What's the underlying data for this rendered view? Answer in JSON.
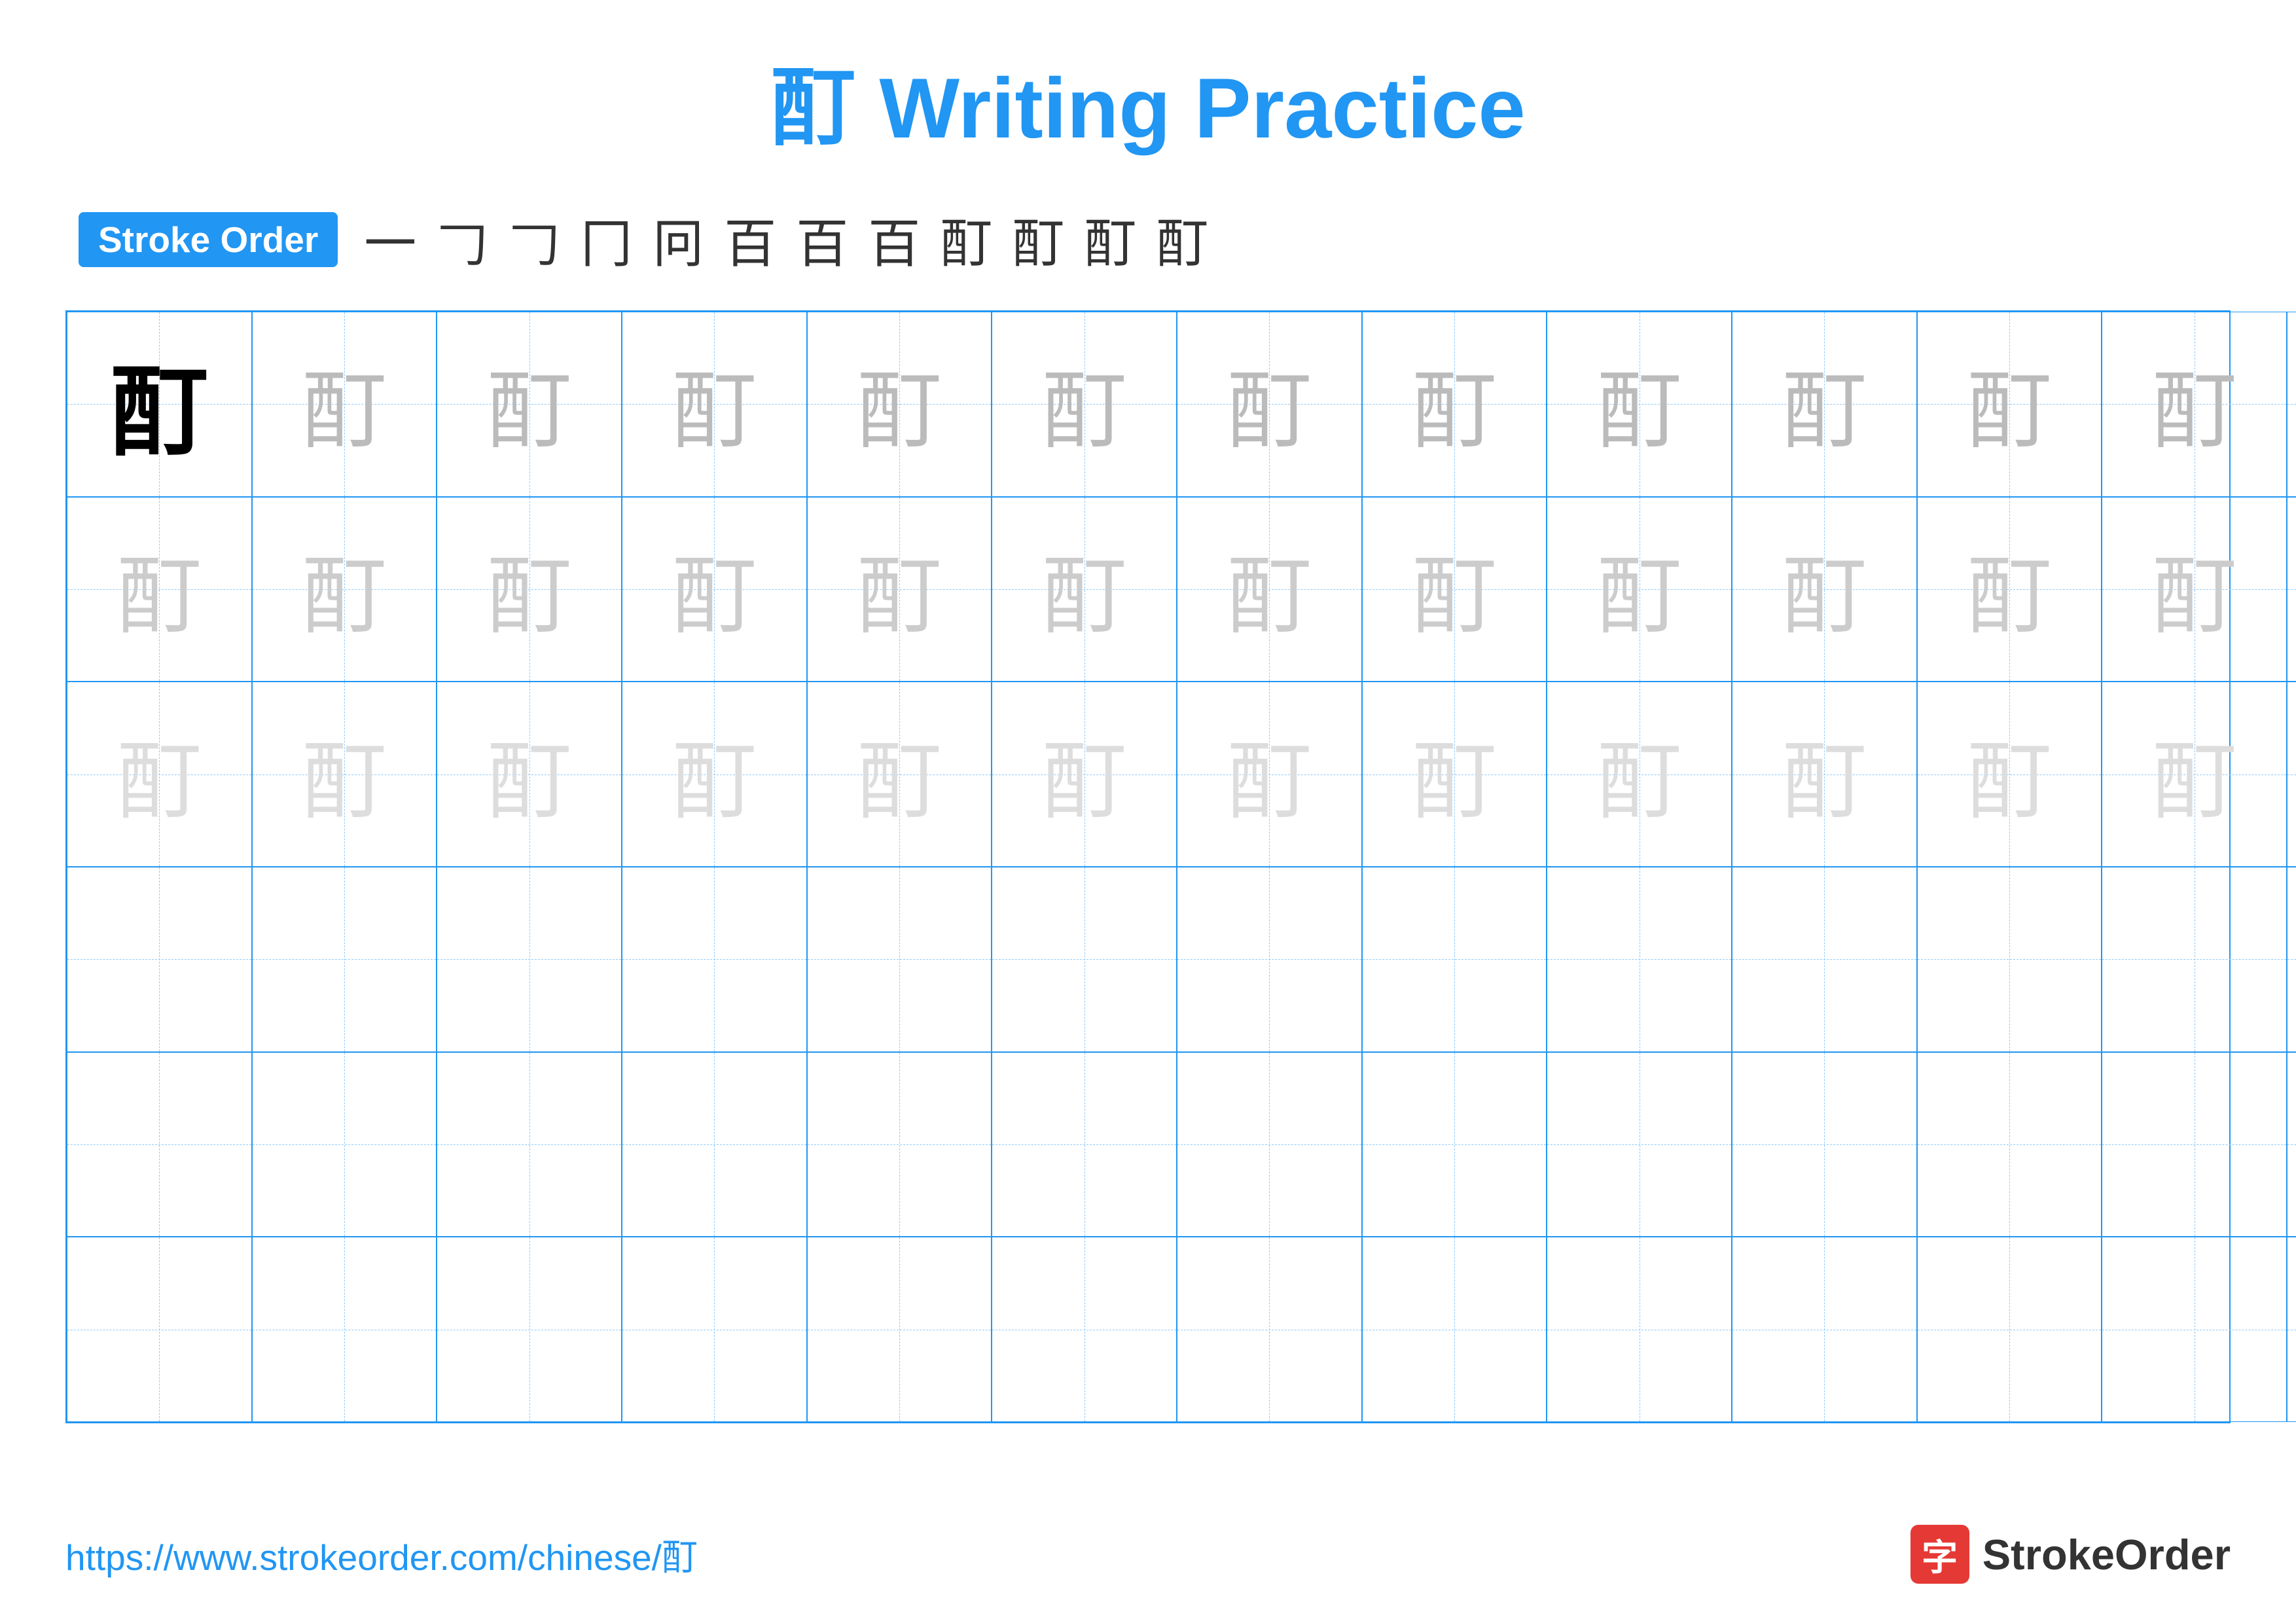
{
  "title": "酊 Writing Practice",
  "stroke_order_badge": "Stroke Order",
  "stroke_sequence": [
    "一",
    "𠃌",
    "𠃌",
    "冂",
    "冋",
    "百",
    "百一",
    "百𠃌",
    "酊𠃌",
    "酊亅",
    "酊亅",
    "酊"
  ],
  "character": "酊",
  "footer_url": "https://www.strokeorder.com/chinese/酊",
  "footer_logo": "StrokeOrder",
  "grid": {
    "rows": 6,
    "cols": 13,
    "row_types": [
      "dark",
      "dark-gray",
      "medium-gray",
      "empty",
      "empty",
      "empty"
    ]
  }
}
